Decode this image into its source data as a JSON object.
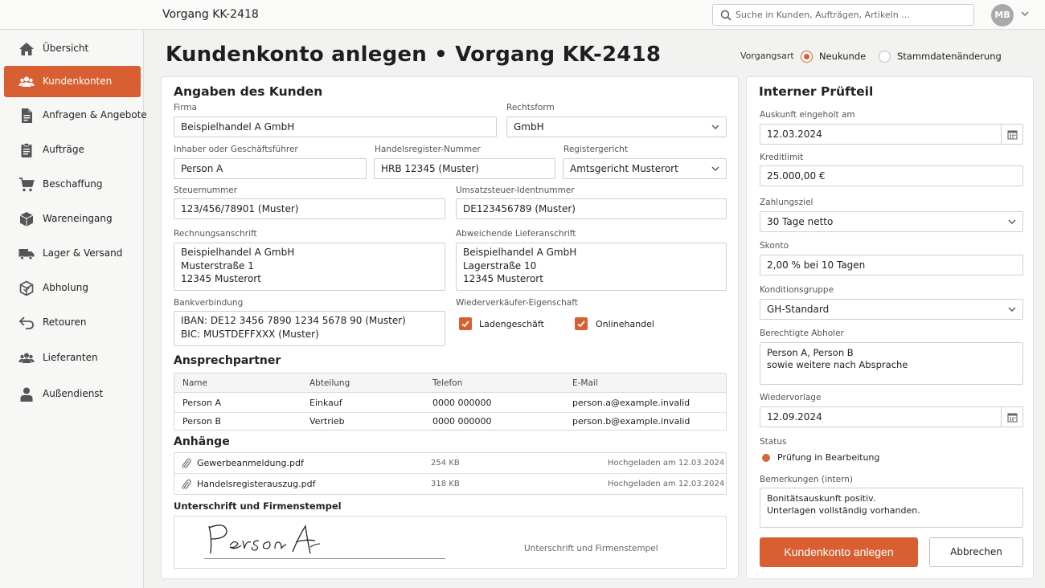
{
  "header": {
    "breadcrumb": "Vorgang KK-2418",
    "search_placeholder": "Suche in Kunden, Aufträgen, Artikeln ...",
    "avatar_initials": "MB"
  },
  "sidebar": {
    "items": [
      {
        "label": "Übersicht",
        "icon": "home-icon"
      },
      {
        "label": "Kundenkonten",
        "icon": "users-icon",
        "active": true
      },
      {
        "label": "Anfragen & Angebote",
        "icon": "document-icon"
      },
      {
        "label": "Aufträge",
        "icon": "clipboard-icon"
      },
      {
        "label": "Beschaffung",
        "icon": "cart-icon"
      },
      {
        "label": "Wareneingang",
        "icon": "box-icon"
      },
      {
        "label": "Lager & Versand",
        "icon": "truck-icon"
      },
      {
        "label": "Abholung",
        "icon": "package-icon"
      },
      {
        "label": "Retouren",
        "icon": "return-icon"
      },
      {
        "label": "Lieferanten",
        "icon": "suppliers-icon"
      },
      {
        "label": "Außendienst",
        "icon": "person-icon"
      }
    ]
  },
  "page": {
    "title": "Kundenkonto anlegen • Vorgang KK-2418",
    "vorgangsart_label": "Vorgangsart",
    "options": [
      "Neukunde",
      "Stammdatenänderung"
    ],
    "selected_option": "Neukunde"
  },
  "customer": {
    "heading": "Angaben des Kunden",
    "firma_label": "Firma",
    "firma": "Beispielhandel A GmbH",
    "rechtsform_label": "Rechtsform",
    "rechtsform": "GmbH",
    "inhaber_label": "Inhaber oder Geschäftsführer",
    "inhaber": "Person A",
    "hr_label": "Handelsregister-Nummer",
    "hr": "HRB 12345 (Muster)",
    "registergericht_label": "Registergericht",
    "registergericht": "Amtsgericht Musterort",
    "steuer_label": "Steuernummer",
    "steuer": "123/456/78901 (Muster)",
    "ust_label": "Umsatzsteuer-Identnummer",
    "ust": "DE123456789 (Muster)",
    "rechnung_label": "Rechnungsanschrift",
    "rechnung": "Beispielhandel A GmbH\nMusterstraße 1\n12345 Musterort",
    "liefer_label": "Abweichende Lieferanschrift",
    "liefer": "Beispielhandel A GmbH\nLagerstraße 10\n12345 Musterort",
    "bank_label": "Bankverbindung",
    "bank": "IBAN: DE12 3456 7890 1234 5678 90 (Muster)\nBIC: MUSTDEFFXXX (Muster)",
    "wieder_label": "Wiederverkäufer-Eigenschaft",
    "wieder_options": [
      {
        "label": "Ladengeschäft",
        "checked": true
      },
      {
        "label": "Onlinehandel",
        "checked": true
      }
    ]
  },
  "contacts": {
    "heading": "Ansprechpartner",
    "columns": [
      "Name",
      "Abteilung",
      "Telefon",
      "E-Mail"
    ],
    "rows": [
      [
        "Person A",
        "Einkauf",
        "0000 000000",
        "person.a@example.invalid"
      ],
      [
        "Person B",
        "Vertrieb",
        "0000 000000",
        "person.b@example.invalid"
      ]
    ]
  },
  "attachments": {
    "heading": "Anhänge",
    "files": [
      {
        "name": "Gewerbeanmeldung.pdf",
        "size": "254 KB",
        "uploaded": "Hochgeladen am 12.03.2024"
      },
      {
        "name": "Handelsregisterauszug.pdf",
        "size": "318 KB",
        "uploaded": "Hochgeladen am 12.03.2024"
      }
    ]
  },
  "signature": {
    "heading": "Unterschrift und Firmenstempel",
    "script": "Person A",
    "caption": "Unterschrift und Firmenstempel"
  },
  "internal": {
    "heading": "Interner Prüfteil",
    "auskunft_label": "Auskunft eingeholt am",
    "auskunft": "12.03.2024",
    "kreditlimit_label": "Kreditlimit",
    "kreditlimit": "25.000,00 €",
    "zahlungsziel_label": "Zahlungsziel",
    "zahlungsziel": "30 Tage netto",
    "skonto_label": "Skonto",
    "skonto": "2,00 % bei 10 Tagen",
    "kondition_label": "Konditionsgruppe",
    "kondition": "GH-Standard",
    "abholer_label": "Berechtigte Abholer",
    "abholer": "Person A, Person B\nsowie weitere nach Absprache",
    "wiedervorlage_label": "Wiedervorlage",
    "wiedervorlage": "12.09.2024",
    "status_label": "Status",
    "status": "Prüfung in Bearbeitung",
    "status_color": "#d26a3c",
    "bemerkungen_label": "Bemerkungen (intern)",
    "bemerkungen": "Bonitätsauskunft positiv.\nUnterlagen vollständig vorhanden."
  },
  "actions": {
    "primary": "Kundenkonto anlegen",
    "secondary": "Abbrechen"
  },
  "colors": {
    "accent": "#d85f32"
  }
}
